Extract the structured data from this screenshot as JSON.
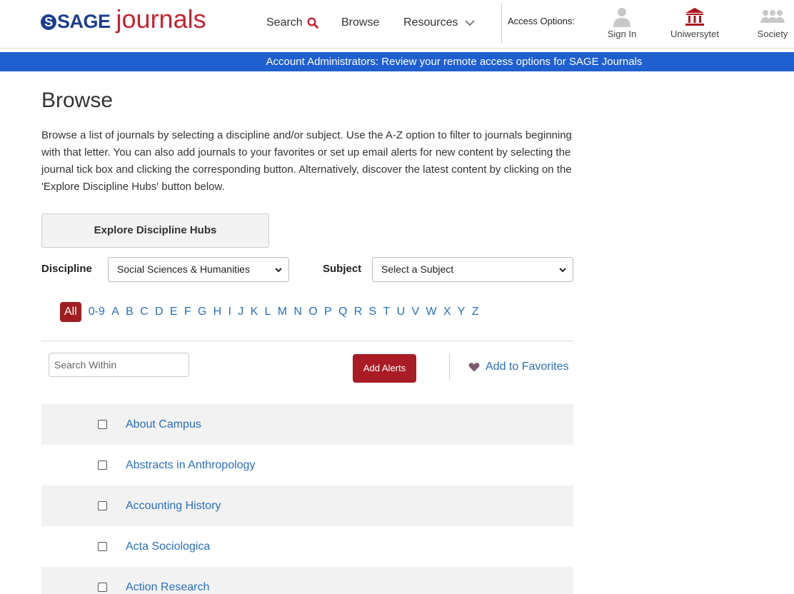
{
  "header": {
    "logo_sage": "SAGE",
    "logo_journals": "journals",
    "nav_search": "Search",
    "nav_browse": "Browse",
    "nav_resources": "Resources",
    "access_label": "Access Options:",
    "sign_in": "Sign In",
    "institution": "Uniwersytet",
    "society": "Society"
  },
  "banner": {
    "text": "Account Administrators: Review your remote access options for SAGE Journals"
  },
  "main": {
    "title": "Browse",
    "intro": "Browse a list of journals by selecting a discipline and/or subject. Use the A-Z option to filter to journals beginning with that letter. You can also add journals to your favorites or set up email alerts for new content by selecting the journal tick box and clicking the corresponding button. Alternatively, discover the latest content by clicking on the 'Explore Discipline Hubs' button below.",
    "hubs_button": "Explore Discipline Hubs",
    "discipline_label": "Discipline",
    "discipline_value": "Social Sciences & Humanities",
    "subject_label": "Subject",
    "subject_value": "Select a Subject",
    "az_all": "All",
    "az_letters": [
      "0-9",
      "A",
      "B",
      "C",
      "D",
      "E",
      "F",
      "G",
      "H",
      "I",
      "J",
      "K",
      "L",
      "M",
      "N",
      "O",
      "P",
      "Q",
      "R",
      "S",
      "T",
      "U",
      "V",
      "W",
      "X",
      "Y",
      "Z"
    ],
    "search_placeholder": "Search Within",
    "add_alerts": "Add Alerts",
    "add_favorites": "Add to Favorites",
    "journals": [
      "About Campus",
      "Abstracts in Anthropology",
      "Accounting History",
      "Acta Sociologica",
      "Action Research"
    ]
  },
  "colors": {
    "brand_blue": "#1c3e8f",
    "brand_red": "#c8202f",
    "banner": "#1f5fcf",
    "link": "#2a6ebd",
    "alert_button": "#a91c25"
  }
}
